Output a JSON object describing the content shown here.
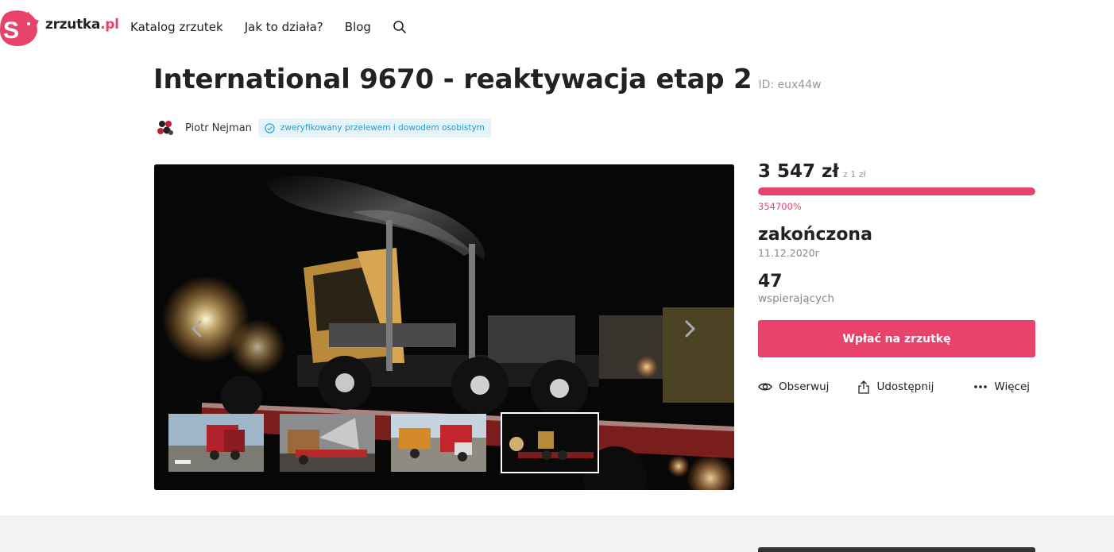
{
  "header": {
    "logo_text": "zrzutka",
    "logo_suffix": ".pl",
    "nav": [
      "Katalog zrzutek",
      "Jak to działa?",
      "Blog"
    ],
    "search_icon": "search-icon"
  },
  "campaign": {
    "title": "International 9670 - reaktywacja etap 2",
    "id_label": "ID: eux44w",
    "author": "Piotr Nejman",
    "verified_text": "zweryfikowany przelewem i dowodem osobistym"
  },
  "stats": {
    "amount": "3 547 zł",
    "goal": "z 1 zł",
    "progress_fraction": 1.0,
    "percent": "354700%",
    "status": "zakończona",
    "end_date": "11.12.2020r",
    "supporters_count": "47",
    "supporters_label": "wspierających"
  },
  "actions": {
    "donate": "Wpłać na zrzutkę",
    "observe": "Obserwuj",
    "share": "Udostępnij",
    "more": "Więcej"
  },
  "gallery": {
    "thumbnail_count": 4,
    "active_thumbnail": 4
  },
  "colors": {
    "brand": "#e8436a",
    "verified": "#1f9bcc"
  }
}
